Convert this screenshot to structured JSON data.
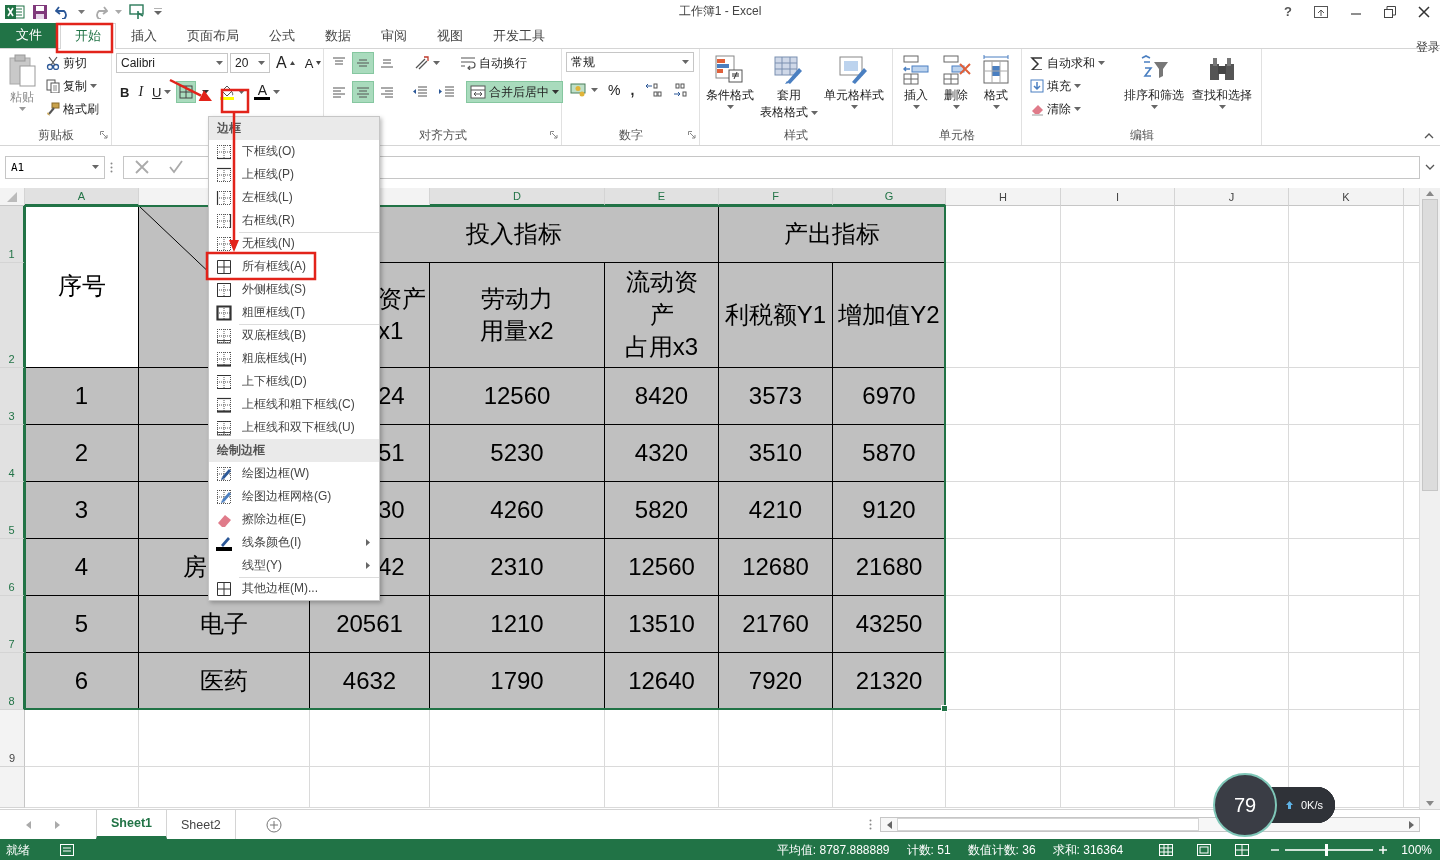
{
  "title_bar": {
    "title": "工作簿1 - Excel",
    "help": "?"
  },
  "ribbon_tabs": [
    {
      "label": "文件",
      "kind": "file",
      "selected": false
    },
    {
      "label": "开始",
      "kind": "tab",
      "selected": true
    },
    {
      "label": "插入",
      "kind": "tab",
      "selected": false
    },
    {
      "label": "页面布局",
      "kind": "tab",
      "selected": false
    },
    {
      "label": "公式",
      "kind": "tab",
      "selected": false
    },
    {
      "label": "数据",
      "kind": "tab",
      "selected": false
    },
    {
      "label": "审阅",
      "kind": "tab",
      "selected": false
    },
    {
      "label": "视图",
      "kind": "tab",
      "selected": false
    },
    {
      "label": "开发工具",
      "kind": "tab",
      "selected": false
    }
  ],
  "account": "登录",
  "ribbon": {
    "clipboard": {
      "label": "剪贴板",
      "paste": "粘贴",
      "cut": "剪切",
      "copy": "复制",
      "format_painter": "格式刷"
    },
    "font": {
      "name": "Calibri",
      "size": "20",
      "grow": "A",
      "shrink": "A",
      "bold": "B",
      "italic": "I",
      "underline": "U",
      "font_color": "A"
    },
    "alignment": {
      "label": "对齐方式",
      "vertical": [
        {
          "kind": "top",
          "selected": false
        },
        {
          "kind": "middle",
          "selected": true
        },
        {
          "kind": "bottom",
          "selected": false
        }
      ],
      "horizontal": [
        {
          "kind": "left",
          "selected": false
        },
        {
          "kind": "center",
          "selected": true
        },
        {
          "kind": "right",
          "selected": false
        }
      ],
      "wrap_text": {
        "label": "自动换行",
        "selected": false
      },
      "merge_center": {
        "label": "合并后居中",
        "selected": true
      }
    },
    "number": {
      "label": "数字",
      "format": "常规",
      "percent": "%",
      "comma": ","
    },
    "styles": {
      "label": "样式",
      "buttons": [
        {
          "lines": [
            "条件格式"
          ],
          "kind": "conditional"
        },
        {
          "lines": [
            "套用",
            "表格格式"
          ],
          "kind": "table"
        },
        {
          "lines": [
            "单元格样式"
          ],
          "kind": "cell_style"
        }
      ]
    },
    "cells": {
      "label": "单元格",
      "buttons": [
        {
          "label": "插入",
          "kind": "insert"
        },
        {
          "label": "删除",
          "kind": "delete"
        },
        {
          "label": "格式",
          "kind": "format"
        }
      ]
    },
    "editing": {
      "label": "编辑",
      "small": [
        {
          "label": "自动求和",
          "kind": "sum"
        },
        {
          "label": "填充",
          "kind": "fill"
        },
        {
          "label": "清除",
          "kind": "clear"
        }
      ],
      "buttons": [
        {
          "label": "排序和筛选",
          "kind": "sort"
        },
        {
          "label": "查找和选择",
          "kind": "find"
        }
      ]
    }
  },
  "formula_bar": {
    "name_box": "A1"
  },
  "sheet": {
    "columns_left": [
      {
        "label": "A",
        "selected": true
      }
    ],
    "columns_right": [
      {
        "label": "D",
        "selected": true
      },
      {
        "label": "E",
        "selected": true
      },
      {
        "label": "F",
        "selected": true
      },
      {
        "label": "G",
        "selected": true
      },
      {
        "label": "H",
        "selected": false
      },
      {
        "label": "I",
        "selected": false
      },
      {
        "label": "J",
        "selected": false
      },
      {
        "label": "K",
        "selected": false
      }
    ],
    "rows": [
      {
        "label": "1",
        "selected": true
      },
      {
        "label": "2",
        "selected": true
      },
      {
        "label": "3",
        "selected": true
      },
      {
        "label": "4",
        "selected": true
      },
      {
        "label": "5",
        "selected": true
      },
      {
        "label": "6",
        "selected": true
      },
      {
        "label": "7",
        "selected": true
      },
      {
        "label": "8",
        "selected": true
      },
      {
        "label": "9",
        "selected": false
      }
    ],
    "header": {
      "number": "序号",
      "input_group": "投入指标",
      "output_group": "产出指标",
      "column_c": {
        "lines": [
          "资产",
          "x1"
        ],
        "covered": true
      },
      "measures": [
        [
          "劳动力",
          "用量x2"
        ],
        [
          "流动资",
          "产",
          "占用x3"
        ],
        [
          "利税额Y1"
        ],
        [
          "增加值Y2"
        ]
      ]
    },
    "data": [
      {
        "number": "1",
        "column_c": {
          "text": "24",
          "covered": true
        },
        "values": [
          "12560",
          "8420",
          "3573",
          "6970"
        ]
      },
      {
        "number": "2",
        "column_c": {
          "text": "51",
          "covered": true
        },
        "values": [
          "5230",
          "4320",
          "3510",
          "5870"
        ]
      },
      {
        "number": "3",
        "column_c": {
          "text": "30",
          "covered": true
        },
        "values": [
          "4260",
          "5820",
          "4210",
          "9120"
        ]
      },
      {
        "number": "4",
        "industry": {
          "text": "房",
          "covered": true
        },
        "column_c": {
          "text": "42",
          "covered": true
        },
        "values": [
          "2310",
          "12560",
          "12680",
          "21680"
        ]
      },
      {
        "number": "5",
        "industry": {
          "text": "电子",
          "covered": false
        },
        "column_c": {
          "text": "20561",
          "covered": false
        },
        "values": [
          "1210",
          "13510",
          "21760",
          "43250"
        ]
      },
      {
        "number": "6",
        "industry": {
          "text": "医药",
          "covered": false
        },
        "column_c": {
          "text": "4632",
          "covered": false
        },
        "values": [
          "1790",
          "12640",
          "7920",
          "21320"
        ]
      }
    ]
  },
  "border_menu": {
    "sections": [
      {
        "title": "边框",
        "items": [
          {
            "label": "下框线(O)",
            "kind": "bottom",
            "divider_above": false,
            "submenu": false
          },
          {
            "label": "上框线(P)",
            "kind": "top",
            "divider_above": false,
            "submenu": false
          },
          {
            "label": "左框线(L)",
            "kind": "left",
            "divider_above": false,
            "submenu": false
          },
          {
            "label": "右框线(R)",
            "kind": "right",
            "divider_above": false,
            "submenu": false
          },
          {
            "label": "无框线(N)",
            "kind": "none",
            "divider_above": true,
            "submenu": false
          },
          {
            "label": "所有框线(A)",
            "kind": "all",
            "divider_above": false,
            "submenu": false
          },
          {
            "label": "外侧框线(S)",
            "kind": "outside",
            "divider_above": false,
            "submenu": false
          },
          {
            "label": "粗匣框线(T)",
            "kind": "thick_box",
            "divider_above": false,
            "submenu": false
          },
          {
            "label": "双底框线(B)",
            "kind": "double_bottom",
            "divider_above": true,
            "submenu": false
          },
          {
            "label": "粗底框线(H)",
            "kind": "thick_bottom",
            "divider_above": false,
            "submenu": false
          },
          {
            "label": "上下框线(D)",
            "kind": "top_bottom",
            "divider_above": false,
            "submenu": false
          },
          {
            "label": "上框线和粗下框线(C)",
            "kind": "top_thick_bottom",
            "divider_above": false,
            "submenu": false
          },
          {
            "label": "上框线和双下框线(U)",
            "kind": "top_double_bottom",
            "divider_above": false,
            "submenu": false
          }
        ]
      },
      {
        "title": "绘制边框",
        "items": [
          {
            "label": "绘图边框(W)",
            "kind": "draw",
            "divider_above": false,
            "submenu": false
          },
          {
            "label": "绘图边框网格(G)",
            "kind": "draw_grid",
            "divider_above": false,
            "submenu": false
          },
          {
            "label": "擦除边框(E)",
            "kind": "erase",
            "divider_above": false,
            "submenu": false
          },
          {
            "label": "线条颜色(I)",
            "kind": "line_color",
            "divider_above": false,
            "submenu": true
          },
          {
            "label": "线型(Y)",
            "divider_above": false,
            "submenu": true
          },
          {
            "label": "其他边框(M)...",
            "kind": "all",
            "divider_above": true,
            "submenu": false
          }
        ]
      }
    ]
  },
  "sheet_tabs": [
    {
      "label": "Sheet1",
      "selected": true
    },
    {
      "label": "Sheet2",
      "selected": false
    }
  ],
  "status_bar": {
    "ready": "就绪",
    "stats": [
      "平均值: 8787.888889",
      "计数: 51",
      "数值计数: 36",
      "求和: 316364"
    ],
    "zoom": {
      "level": 0.45
    },
    "zoom_text": "100%"
  },
  "speed_widget": {
    "cpu": "79",
    "upload": "0K/s"
  }
}
